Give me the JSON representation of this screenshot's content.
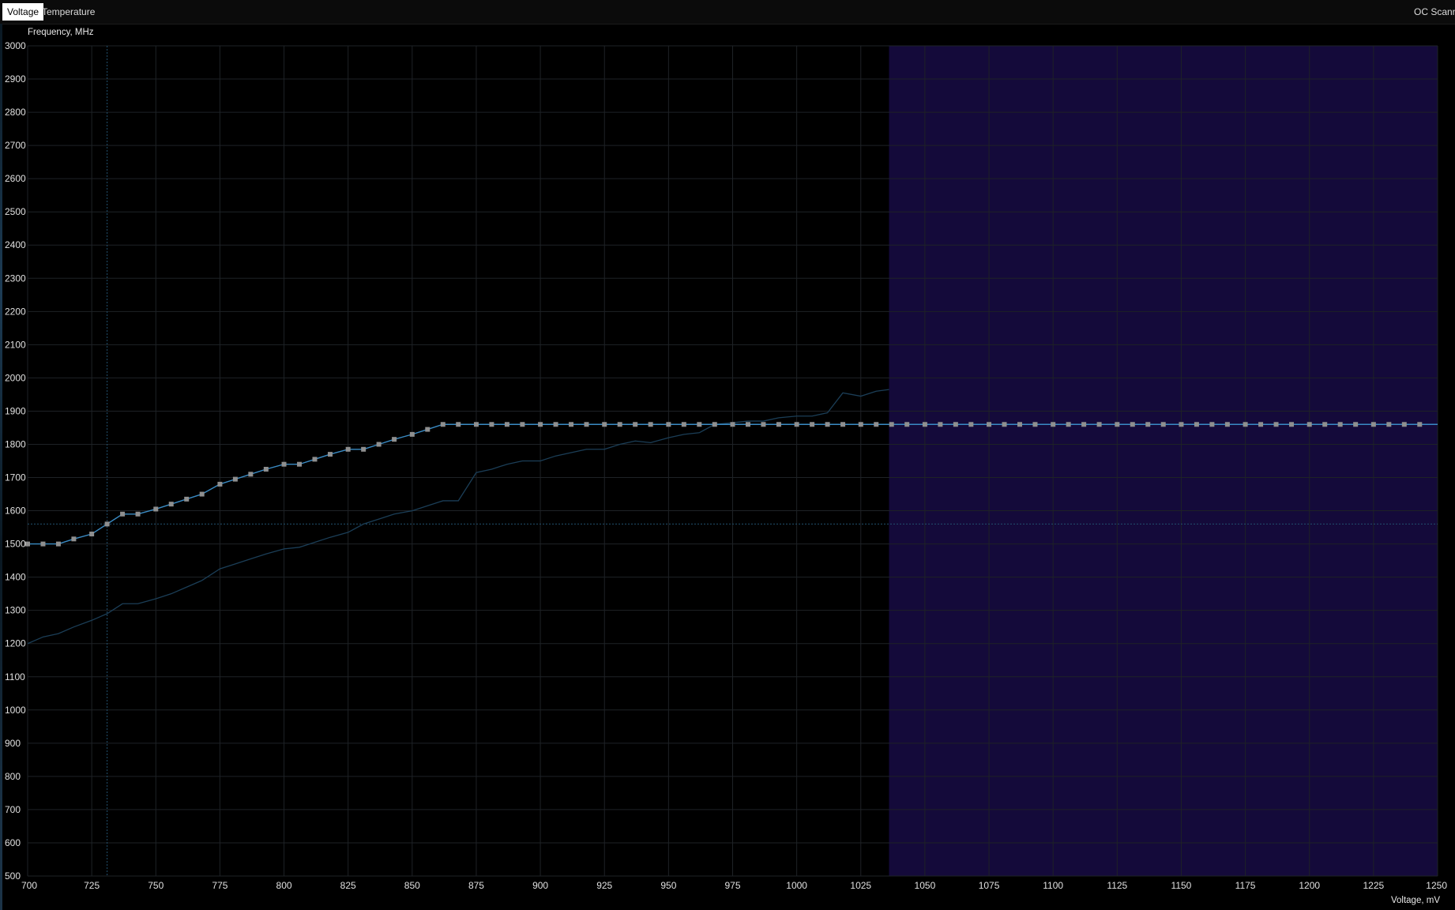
{
  "tabs": [
    {
      "label": "Voltage",
      "active": true
    },
    {
      "label": "Temperature",
      "active": false
    }
  ],
  "oc_scanner_label": "OC Scanner",
  "colors": {
    "background": "#000000",
    "grid": "#1e2226",
    "curve": "#3a8bc4",
    "curve_points": "#8f8f8f",
    "reference_curve": "#1b3e57",
    "locked_region": "#140a3a"
  },
  "chart_data": {
    "type": "line",
    "title": "",
    "ylabel": "Frequency, MHz",
    "xlabel": "Voltage, mV",
    "xlim": [
      700,
      1250
    ],
    "ylim": [
      500,
      3000
    ],
    "x_ticks": [
      700,
      725,
      750,
      775,
      800,
      825,
      850,
      875,
      900,
      925,
      950,
      975,
      1000,
      1025,
      1050,
      1075,
      1100,
      1125,
      1150,
      1175,
      1200,
      1225,
      1250
    ],
    "y_ticks": [
      500,
      600,
      700,
      800,
      900,
      1000,
      1100,
      1200,
      1300,
      1400,
      1500,
      1600,
      1700,
      1800,
      1900,
      2000,
      2100,
      2200,
      2300,
      2400,
      2500,
      2600,
      2700,
      2800,
      2900,
      3000
    ],
    "grid": true,
    "cursor": {
      "voltage": 731,
      "frequency": 1560
    },
    "highlight_region": {
      "x_start": 1036,
      "x_end": 1250
    },
    "series": [
      {
        "x": [
          700,
          706,
          712,
          718,
          725,
          731,
          737,
          743,
          750,
          756,
          762,
          768,
          775,
          781,
          787,
          793,
          800,
          806,
          812,
          818,
          825,
          831,
          837,
          843,
          850,
          856,
          862,
          868,
          875,
          881,
          887,
          893,
          900,
          906,
          912,
          918,
          925,
          931,
          937,
          943,
          950,
          956,
          962,
          968,
          975,
          981,
          987,
          993,
          1000,
          1006,
          1012,
          1018,
          1025,
          1031,
          1037,
          1043,
          1050,
          1056,
          1062,
          1068,
          1075,
          1081,
          1087,
          1093,
          1100,
          1106,
          1112,
          1118,
          1125,
          1131,
          1137,
          1143,
          1150,
          1156,
          1162,
          1168,
          1175,
          1181,
          1187,
          1193,
          1200,
          1206,
          1212,
          1218,
          1225,
          1231,
          1237,
          1243
        ],
        "y": [
          1500,
          1500,
          1500,
          1515,
          1530,
          1560,
          1590,
          1590,
          1605,
          1620,
          1635,
          1650,
          1680,
          1695,
          1710,
          1725,
          1740,
          1740,
          1755,
          1770,
          1785,
          1785,
          1800,
          1815,
          1830,
          1845,
          1860,
          1860,
          1860,
          1860,
          1860,
          1860,
          1860,
          1860,
          1860,
          1860,
          1860,
          1860,
          1860,
          1860,
          1860,
          1860,
          1860,
          1860,
          1860,
          1860,
          1860,
          1860,
          1860,
          1860,
          1860,
          1860,
          1860,
          1860,
          1860,
          1860,
          1860,
          1860,
          1860,
          1860,
          1860,
          1860,
          1860,
          1860,
          1860,
          1860,
          1860,
          1860,
          1860,
          1860,
          1860,
          1860,
          1860,
          1860,
          1860,
          1860,
          1860,
          1860,
          1860,
          1860,
          1860,
          1860,
          1860,
          1860,
          1860,
          1860,
          1860,
          1860
        ]
      },
      {
        "x": [
          700,
          706,
          712,
          718,
          725,
          731,
          737,
          743,
          750,
          756,
          762,
          768,
          775,
          781,
          787,
          793,
          800,
          806,
          812,
          818,
          825,
          831,
          837,
          843,
          850,
          856,
          862,
          868,
          875,
          881,
          887,
          893,
          900,
          906,
          912,
          918,
          925,
          931,
          937,
          943,
          950,
          956,
          962,
          968,
          975,
          981,
          987,
          993,
          1000,
          1006,
          1012,
          1018,
          1025,
          1031,
          1036
        ],
        "y": [
          1200,
          1220,
          1230,
          1250,
          1270,
          1290,
          1320,
          1320,
          1335,
          1350,
          1370,
          1390,
          1425,
          1440,
          1455,
          1470,
          1485,
          1490,
          1505,
          1520,
          1535,
          1560,
          1575,
          1590,
          1600,
          1615,
          1630,
          1630,
          1715,
          1725,
          1740,
          1750,
          1750,
          1765,
          1775,
          1785,
          1785,
          1800,
          1810,
          1805,
          1820,
          1830,
          1835,
          1860,
          1865,
          1870,
          1870,
          1880,
          1885,
          1885,
          1895,
          1955,
          1945,
          1960,
          1965
        ]
      }
    ]
  }
}
